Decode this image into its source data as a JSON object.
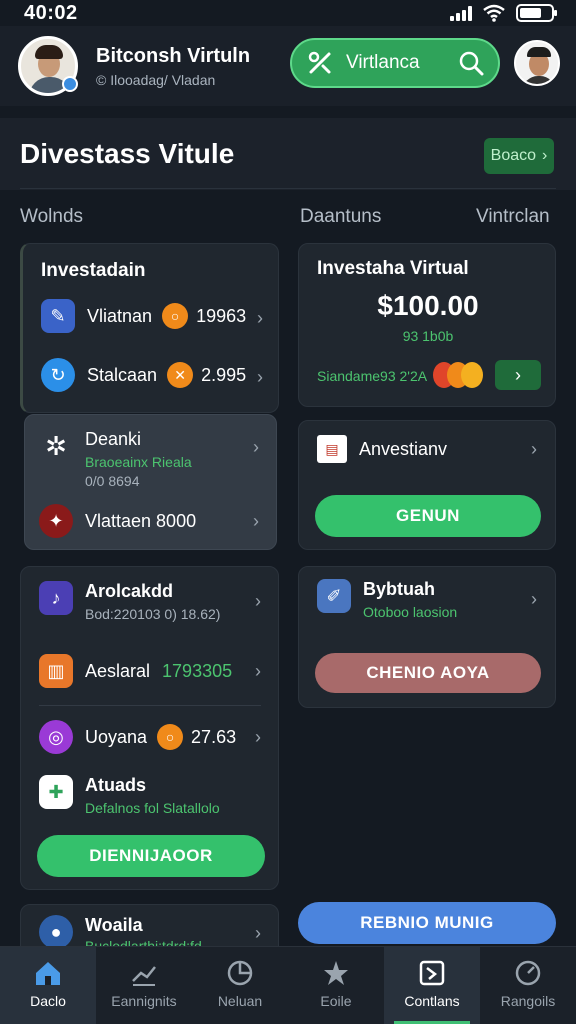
{
  "status": {
    "time": "40:02"
  },
  "header": {
    "user_name": "Bitconsh Virtuln",
    "user_sub": "© Ilooadag/ Vladan",
    "search_label": "Virtlanca"
  },
  "title": {
    "text": "Divestass Vitule",
    "button": "Boaco"
  },
  "sections": {
    "left": "Wolnds",
    "center": "Daantuns",
    "right": "Vintrclan"
  },
  "left_card1": {
    "title": "Investadain",
    "rows": [
      {
        "label": "Vliatnan",
        "value": "19963"
      },
      {
        "label": "Stalcaan",
        "value": "2.995"
      }
    ]
  },
  "left_card2": {
    "rows": [
      {
        "label": "Deanki",
        "sub1": "Braoeainx Rieala",
        "sub2": "0/0 8694",
        "value": ""
      },
      {
        "label": "Vlattaen 8000"
      }
    ]
  },
  "right_card1": {
    "title": "Investaha Virtual",
    "amount": "$100.00",
    "amount_sub": "93 1b0b",
    "status_text": "Siandame93 2'2A"
  },
  "right_card2": {
    "label": "Anvestianv",
    "button": "GENUN"
  },
  "left_card3": {
    "rows": [
      {
        "label": "Arolcakdd",
        "sub": "Bod:220103 0) 18.62)"
      },
      {
        "label": "Aeslaral",
        "value": "1793305"
      },
      {
        "label": "Uoyana",
        "value": "27.63"
      },
      {
        "label": "Atuads",
        "sub": "Defalnos fol Slatallolo"
      }
    ],
    "button": "DIENNIJAOOR"
  },
  "right_card3": {
    "label": "Bybtuah",
    "sub": "Otoboo laosion",
    "button": "CHENIO AOYA"
  },
  "left_card4": {
    "label": "Woaila",
    "sub": "Buclodlarthi:tdrd:fd"
  },
  "bottom_button": "REBNIO MUNIG",
  "nav": [
    {
      "label": "Daclo"
    },
    {
      "label": "Eannignits"
    },
    {
      "label": "Neluan"
    },
    {
      "label": "Eoile"
    },
    {
      "label": "Contlans"
    },
    {
      "label": "Rangoils"
    }
  ],
  "colors": {
    "accent_green": "#34c16c",
    "bg": "#141a22",
    "card": "#20272f",
    "blue": "#4b84dd"
  }
}
